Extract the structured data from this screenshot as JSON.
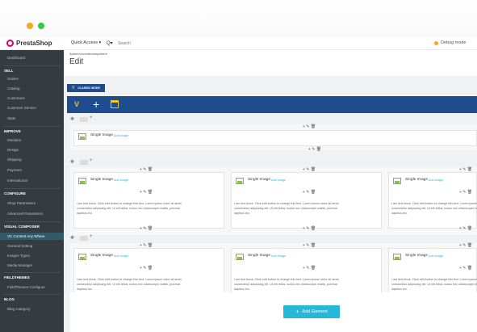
{
  "topbar": {
    "brand": "PrestaShop",
    "quick_access": "Quick Access ▾",
    "search_icon": "Q▾",
    "search_placeholder": "Search",
    "debug_mode": "Debug mode"
  },
  "sidebar": {
    "items": [
      {
        "kind": "item",
        "label": "Dashboard"
      },
      {
        "kind": "head",
        "label": "SELL"
      },
      {
        "kind": "item",
        "label": "Orders"
      },
      {
        "kind": "item",
        "label": "Catalog"
      },
      {
        "kind": "item",
        "label": "Customers"
      },
      {
        "kind": "item",
        "label": "Customer Service"
      },
      {
        "kind": "item",
        "label": "Stats"
      },
      {
        "kind": "head",
        "label": "IMPROVE"
      },
      {
        "kind": "item",
        "label": "Modules"
      },
      {
        "kind": "item",
        "label": "Design"
      },
      {
        "kind": "item",
        "label": "Shipping"
      },
      {
        "kind": "item",
        "label": "Payment"
      },
      {
        "kind": "item",
        "label": "International"
      },
      {
        "kind": "head",
        "label": "CONFIGURE"
      },
      {
        "kind": "item",
        "label": "Shop Parameters"
      },
      {
        "kind": "item",
        "label": "Advanced Parameters"
      },
      {
        "kind": "head",
        "label": "VISUAL COMPOSER"
      },
      {
        "kind": "item",
        "label": "VC Content Any Where",
        "active": true
      },
      {
        "kind": "item",
        "label": "General Setting"
      },
      {
        "kind": "item",
        "label": "Images Types"
      },
      {
        "kind": "item",
        "label": "Media Manager"
      },
      {
        "kind": "head",
        "label": "FIELDTHEMES"
      },
      {
        "kind": "item",
        "label": "FieldThemes Configure"
      },
      {
        "kind": "head",
        "label": "BLOG"
      },
      {
        "kind": "item",
        "label": "Blog Category"
      }
    ]
  },
  "header": {
    "breadcrumb": "Admin/vccontentanywhere",
    "title": "Edit"
  },
  "editor": {
    "classic_mode": "CLASSIC MODE",
    "single_image": "Single Image",
    "add_image": "Add image",
    "text_line1": "I am text block. Click edit button to change this text. Lorem ipsum dolor sit amet,",
    "text_line2": "consectetur adipiscing elit. Ut elit tellus, luctus nec ullamcorper mattis, pulvinar",
    "text_line3": "dapibus leo.",
    "add_element": "Add Element"
  },
  "colors": {
    "sidebar_bg": "#363a41",
    "vc_toolbar": "#1f4c8f",
    "accent": "#25b9d7",
    "debug_dot": "#f5a623"
  }
}
